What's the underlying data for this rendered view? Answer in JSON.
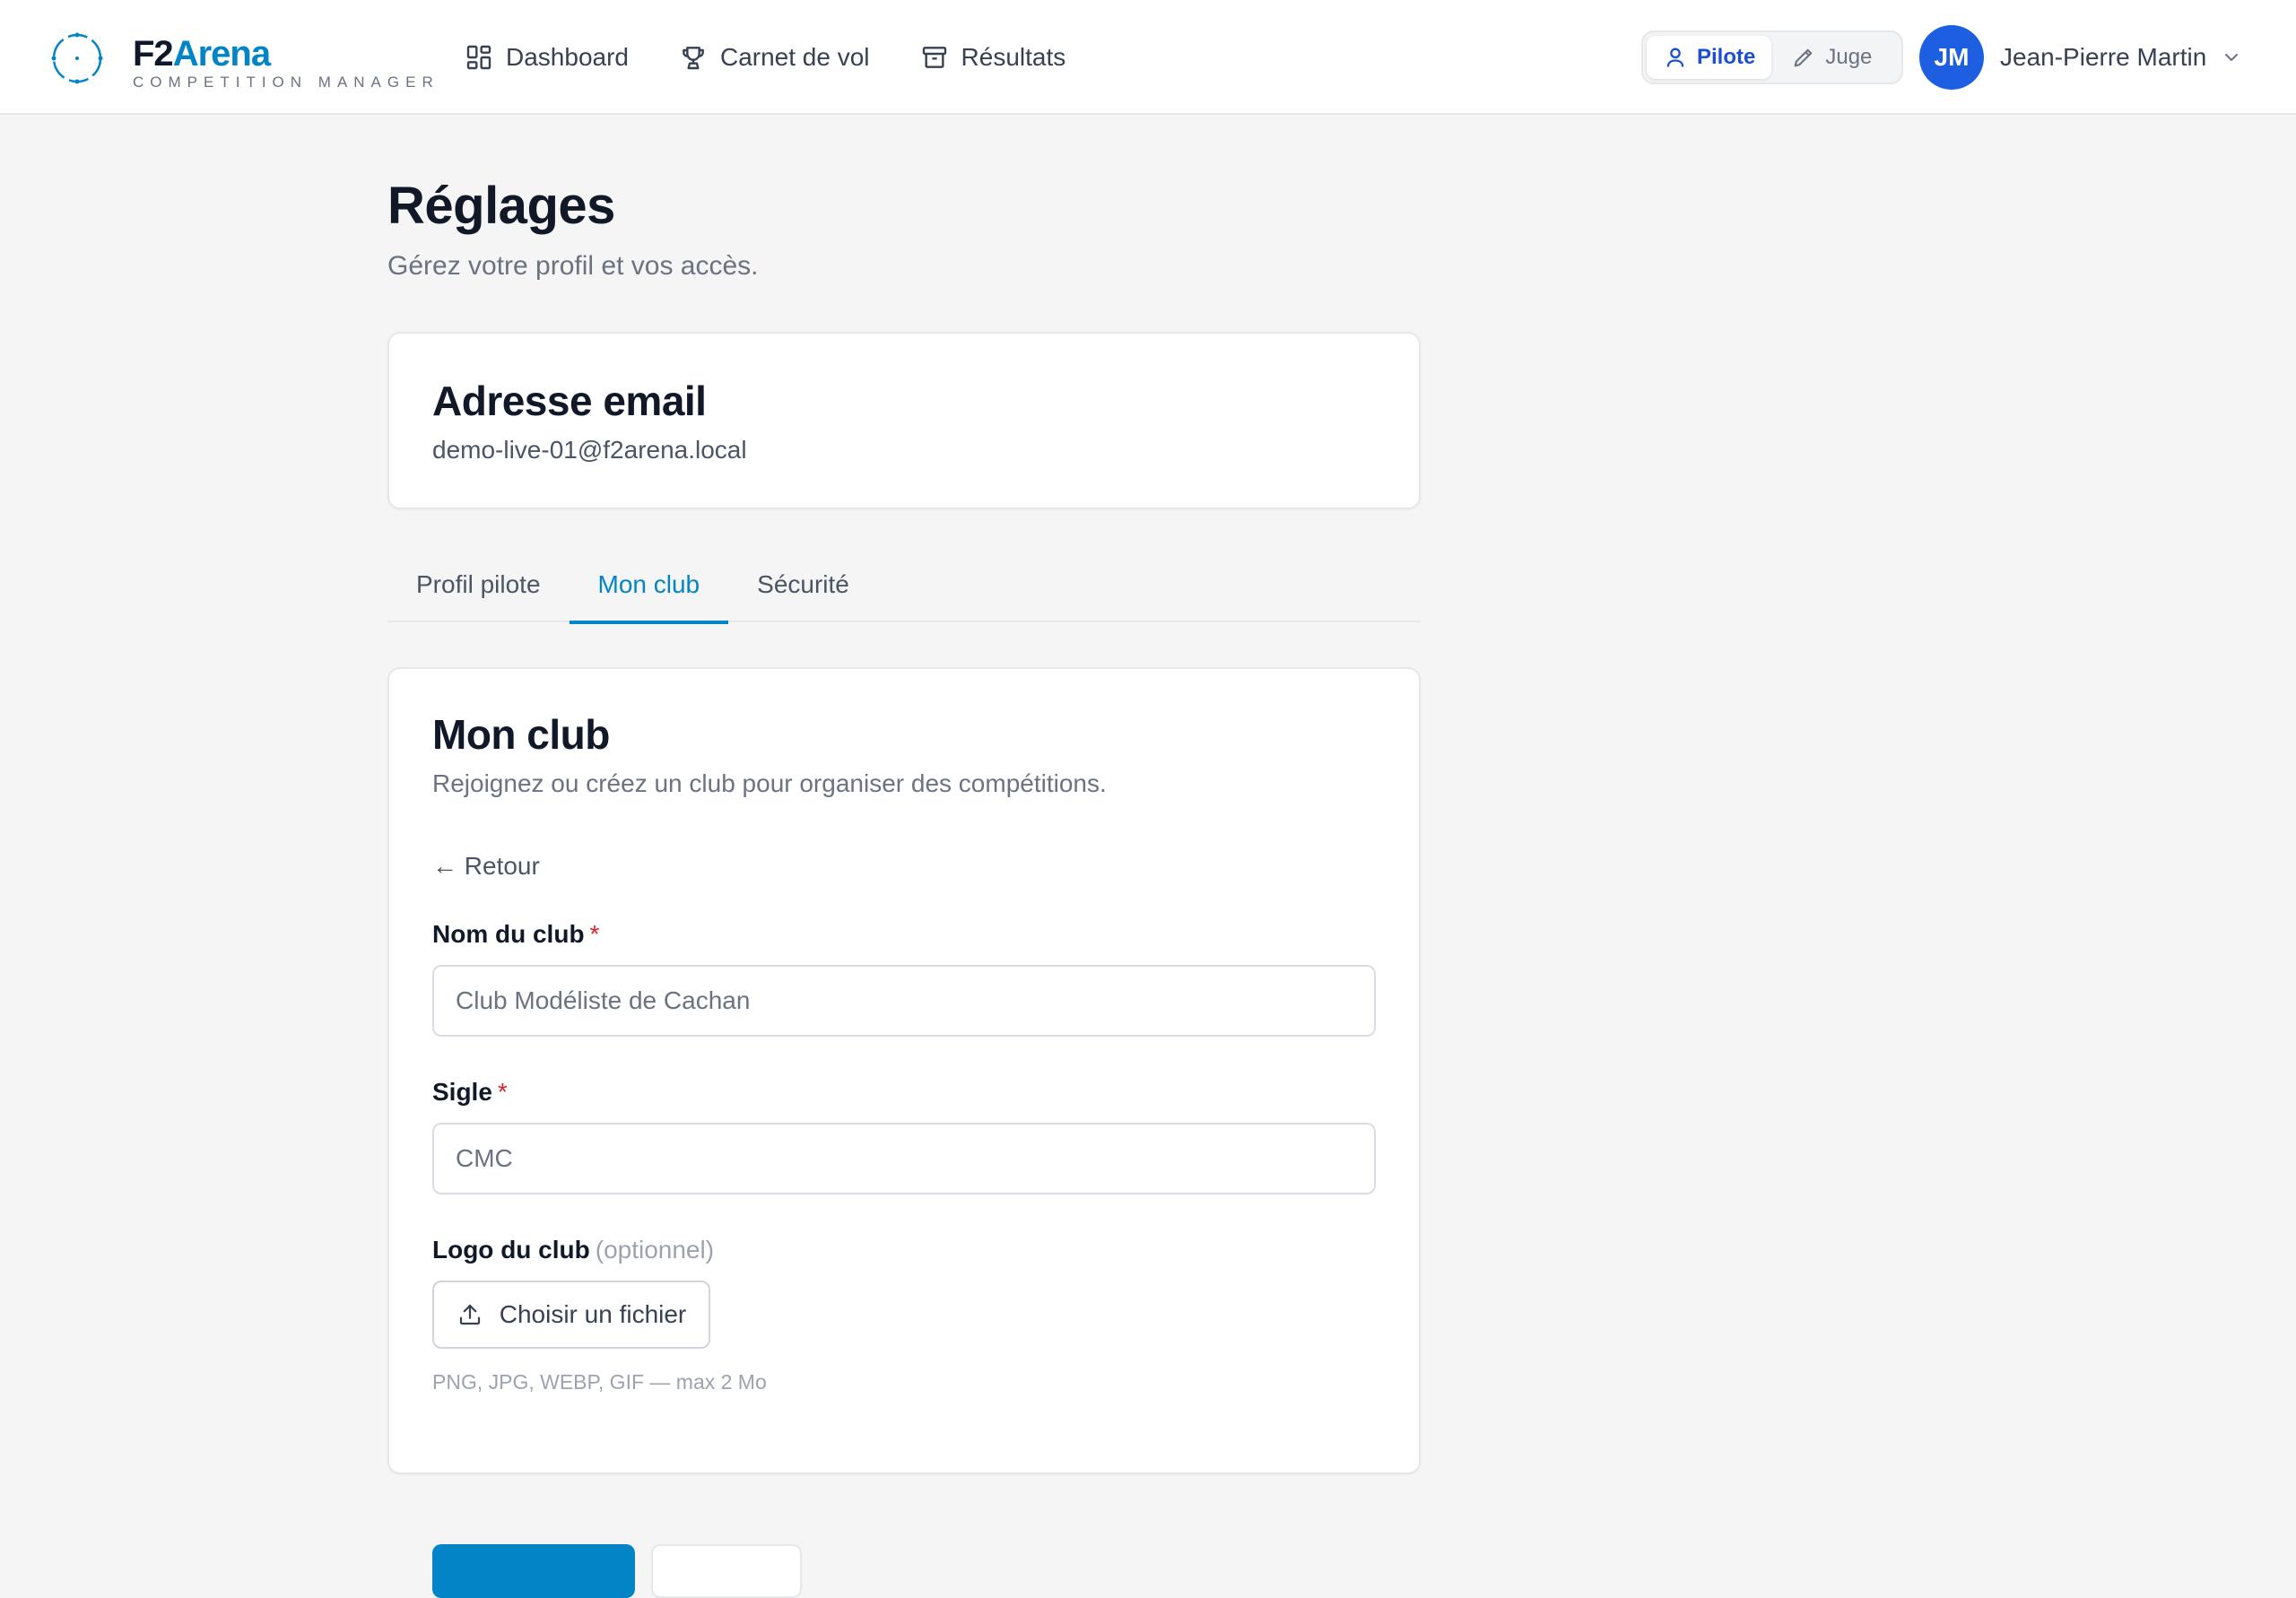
{
  "brand": {
    "name_part1": "F2",
    "name_part2": "Arena",
    "tagline": "COMPETITION MANAGER"
  },
  "nav": [
    {
      "label": "Dashboard",
      "icon": "grid-icon"
    },
    {
      "label": "Carnet de vol",
      "icon": "trophy-icon"
    },
    {
      "label": "Résultats",
      "icon": "archive-icon"
    }
  ],
  "roles": {
    "pilot_label": "Pilote",
    "judge_label": "Juge",
    "active": "Pilote"
  },
  "user": {
    "initials": "JM",
    "name": "Jean-Pierre Martin"
  },
  "page": {
    "title": "Réglages",
    "subtitle": "Gérez votre profil et vos accès."
  },
  "email_card": {
    "title": "Adresse email",
    "value": "demo-live-01@f2arena.local"
  },
  "tabs": [
    {
      "label": "Profil pilote",
      "active": false
    },
    {
      "label": "Mon club",
      "active": true
    },
    {
      "label": "Sécurité",
      "active": false
    }
  ],
  "club_card": {
    "title": "Mon club",
    "subtitle": "Rejoignez ou créez un club pour organiser des compétitions.",
    "back_label": "← Retour",
    "name_label": "Nom du club",
    "name_required": "*",
    "name_placeholder": "Club Modéliste de Cachan",
    "acronym_label": "Sigle",
    "acronym_required": "*",
    "acronym_placeholder": "CMC",
    "logo_label": "Logo du club",
    "logo_optional": "(optionnel)",
    "file_button_label": "Choisir un fichier",
    "file_hint": "PNG, JPG, WEBP, GIF — max 2 Mo"
  },
  "colors": {
    "accent": "#0284c7",
    "avatar": "#1d5fe0",
    "required": "#dc2626"
  }
}
